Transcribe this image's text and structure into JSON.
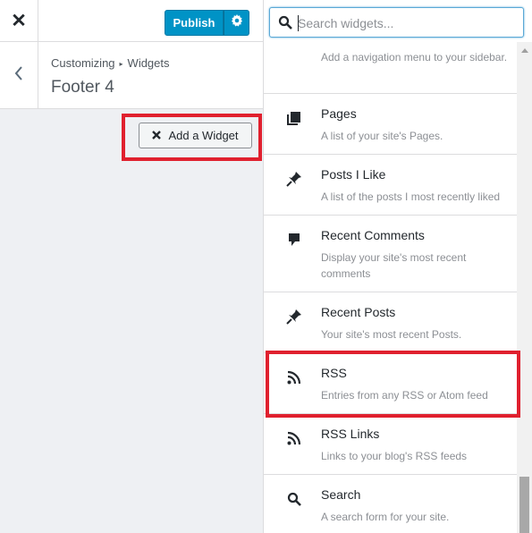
{
  "topbar": {
    "close_glyph": "✕",
    "publish_label": "Publish"
  },
  "header": {
    "breadcrumb_root": "Customizing",
    "breadcrumb_sep": "▸",
    "breadcrumb_current": "Widgets",
    "title": "Footer 4"
  },
  "add_widget": {
    "label": "Add a Widget"
  },
  "search": {
    "placeholder": "Search widgets..."
  },
  "widgets": [
    {
      "title": "",
      "desc": "Add a navigation menu to your sidebar.",
      "icon": "menu-icon"
    },
    {
      "title": "Pages",
      "desc": "A list of your site's Pages.",
      "icon": "pages-icon"
    },
    {
      "title": "Posts I Like",
      "desc": "A list of the posts I most recently liked",
      "icon": "pin-icon"
    },
    {
      "title": "Recent Comments",
      "desc": "Display your site's most recent comments",
      "icon": "comment-icon"
    },
    {
      "title": "Recent Posts",
      "desc": "Your site's most recent Posts.",
      "icon": "pin-icon"
    },
    {
      "title": "RSS",
      "desc": "Entries from any RSS or Atom feed",
      "icon": "rss-icon"
    },
    {
      "title": "RSS Links",
      "desc": "Links to your blog's RSS feeds",
      "icon": "rss-icon"
    },
    {
      "title": "Search",
      "desc": "A search form for your site.",
      "icon": "search-icon"
    }
  ],
  "colors": {
    "accent": "#0093c6",
    "highlight": "#e0202e",
    "panel_bg": "#eef0f3"
  }
}
